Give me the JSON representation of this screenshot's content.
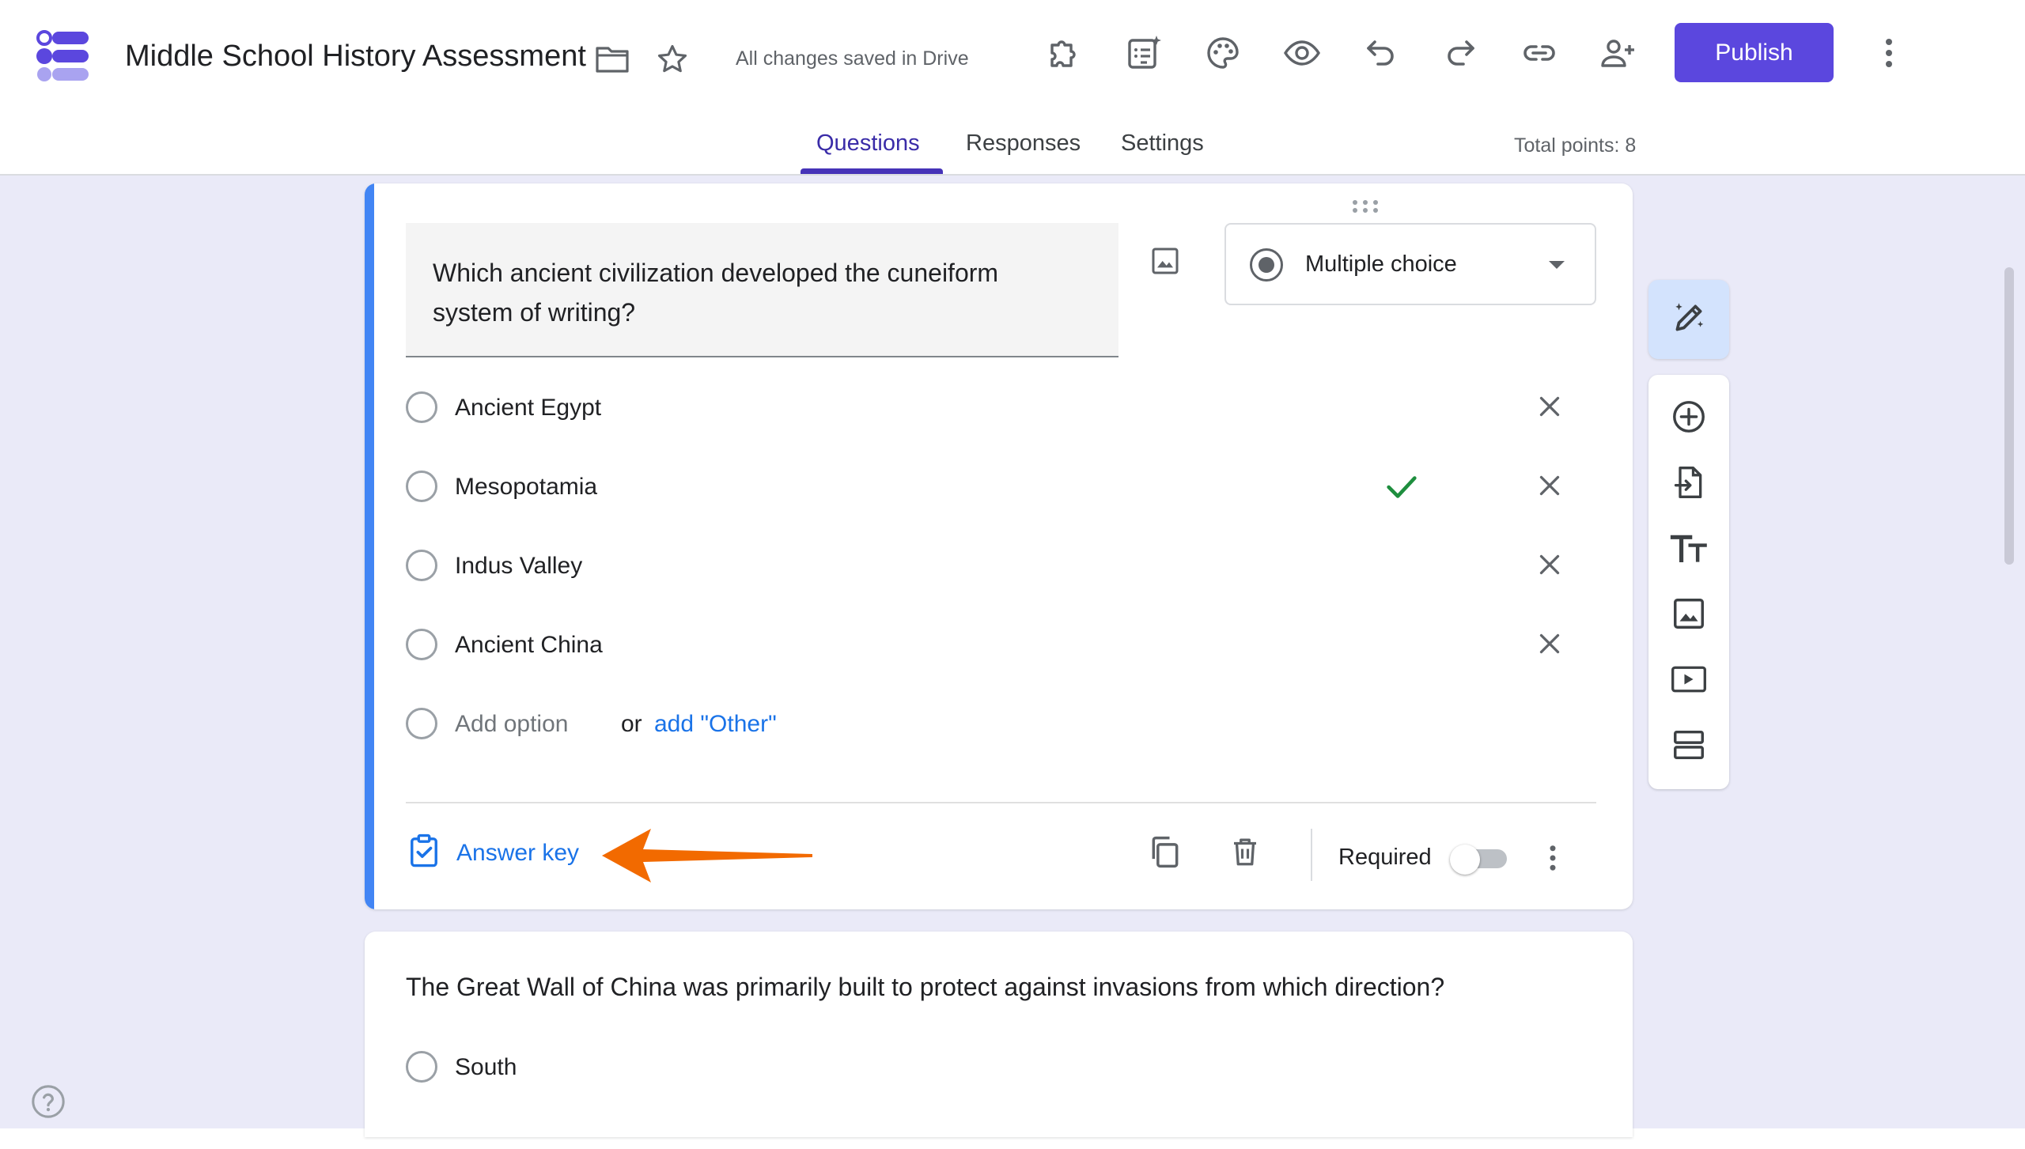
{
  "header": {
    "title": "Middle School History Assessment",
    "save_status": "All changes saved in Drive",
    "publish_label": "Publish",
    "tabs": [
      {
        "label": "Questions",
        "active": true
      },
      {
        "label": "Responses",
        "active": false
      },
      {
        "label": "Settings",
        "active": false
      }
    ],
    "total_points": "Total points: 8"
  },
  "question1": {
    "text": "Which ancient civilization developed the cuneiform system of writing?",
    "type_label": "Multiple choice",
    "options": [
      {
        "label": "Ancient Egypt",
        "correct": false
      },
      {
        "label": "Mesopotamia",
        "correct": true
      },
      {
        "label": "Indus Valley",
        "correct": false
      },
      {
        "label": "Ancient China",
        "correct": false
      }
    ],
    "add_option": "Add option",
    "or": "or",
    "add_other": "add \"Other\"",
    "answer_key_label": "Answer key",
    "required_label": "Required",
    "required": false
  },
  "question2": {
    "text": "The Great Wall of China was primarily built to protect against invasions from which direction?",
    "options": [
      {
        "label": "South"
      }
    ]
  },
  "colors": {
    "accent_blue": "#4285f4",
    "publish_purple": "#5b47de",
    "link_blue": "#1a73e8",
    "correct_green": "#1e8e3e",
    "annotation_orange": "#f26a00",
    "canvas_background": "#eaeaf8"
  },
  "icons": {
    "header": [
      "forms-logo",
      "folder-icon",
      "star-icon",
      "addons-icon",
      "ai-form-icon",
      "palette-icon",
      "preview-eye-icon",
      "undo-icon",
      "redo-icon",
      "link-icon",
      "add-collaborator-icon",
      "more-vert-icon"
    ],
    "toolbar": [
      "ai-edit-icon",
      "add-question-icon",
      "import-questions-icon",
      "title-text-icon",
      "image-icon",
      "video-icon",
      "section-icon"
    ]
  }
}
